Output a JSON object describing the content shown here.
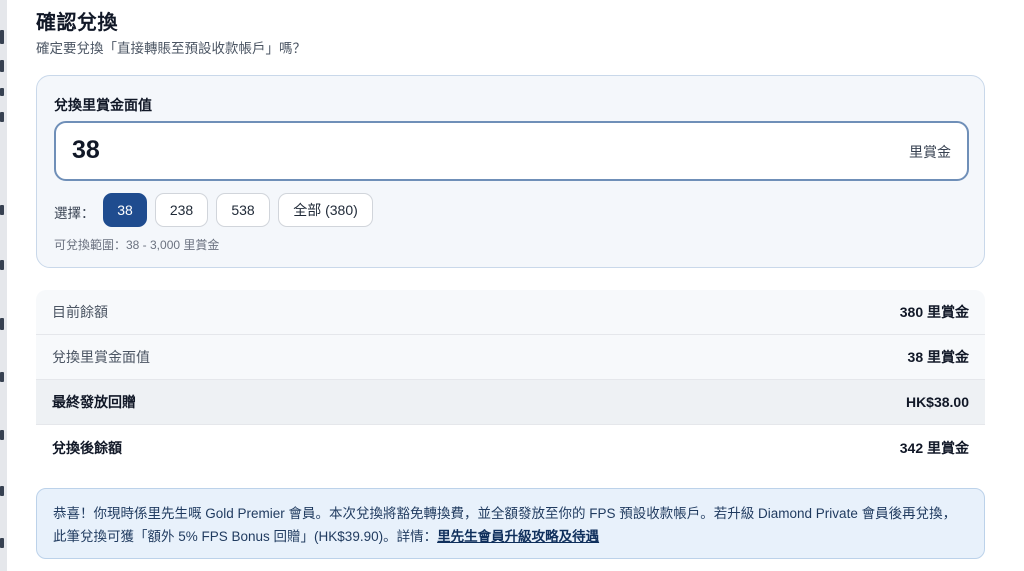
{
  "dialog": {
    "title": "確認兌換",
    "subtitle": "確定要兌換「直接轉賬至預設收款帳戶」嗎？"
  },
  "redeem": {
    "label": "兌換里賞金面值",
    "amount": "38",
    "unit": "里賞金",
    "choose_label": "選擇：",
    "options": [
      "38",
      "238",
      "538",
      "全部 (380)"
    ],
    "selected_option": "38",
    "range_note": "可兌換範圍：38 - 3,000 里賞金"
  },
  "summary": {
    "rows": [
      {
        "label": "目前餘額",
        "value": "380 里賞金"
      },
      {
        "label": "兌換里賞金面值",
        "value": "38 里賞金"
      },
      {
        "label": "最終發放回贈",
        "value": "HK$38.00"
      },
      {
        "label": "兌換後餘額",
        "value": "342 里賞金"
      }
    ]
  },
  "notice": {
    "text": "恭喜！你現時係里先生嘅 Gold Premier 會員。本次兌換將豁免轉換費，並全額發放至你的 FPS 預設收款帳戶。若升級 Diamond Private 會員後再兌換，此筆兌換可獲「額外 5% FPS Bonus 回贈」(HK$39.90)。詳情：",
    "link_text": "里先生會員升級攻略及待遇"
  },
  "colors": {
    "accent": "#1f4c8f",
    "card_bg": "#f4f7fb",
    "notice_bg": "#e8f1fb"
  }
}
